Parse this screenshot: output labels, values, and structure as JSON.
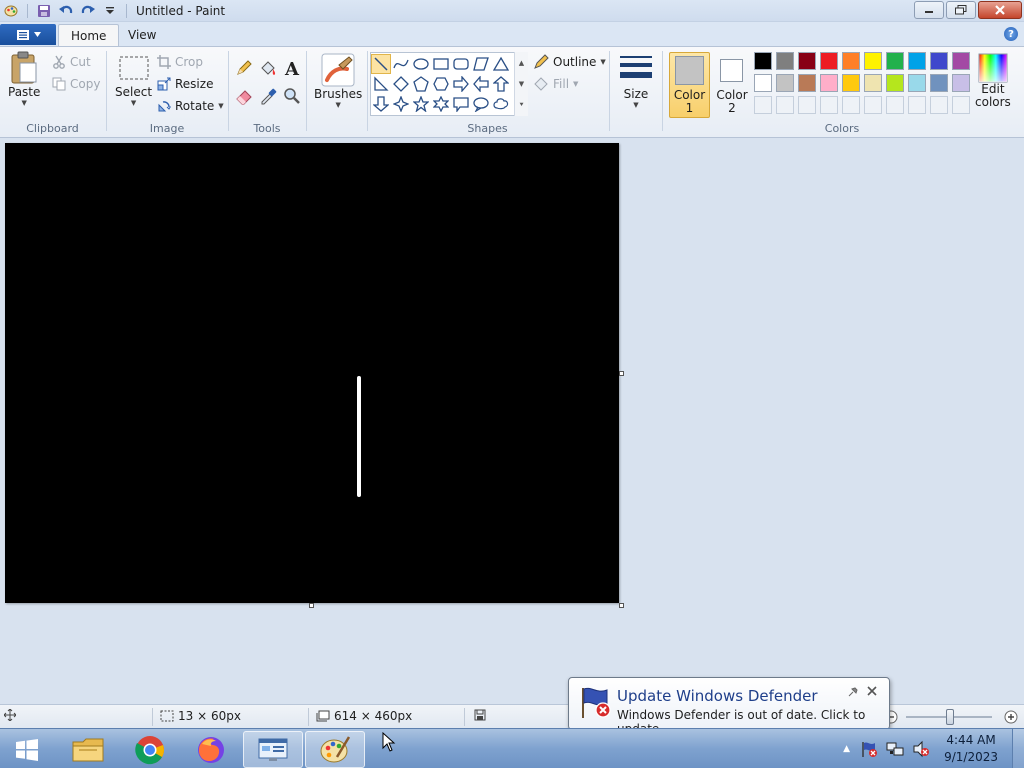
{
  "window": {
    "title": "Untitled - Paint"
  },
  "tabs": [
    {
      "label": "Home"
    },
    {
      "label": "View"
    }
  ],
  "ribbon": {
    "clipboard": {
      "label": "Clipboard",
      "paste": "Paste",
      "cut": "Cut",
      "copy": "Copy"
    },
    "image": {
      "label": "Image",
      "select": "Select",
      "crop": "Crop",
      "resize": "Resize",
      "rotate": "Rotate"
    },
    "tools": {
      "label": "Tools"
    },
    "brushes": {
      "label": "Brushes"
    },
    "shapes": {
      "label": "Shapes",
      "outline": "Outline",
      "fill": "Fill"
    },
    "size": {
      "label": "Size"
    },
    "colors": {
      "label": "Colors",
      "color1_line1": "Color",
      "color1_line2": "1",
      "color2_line1": "Color",
      "color2_line2": "2",
      "edit_line1": "Edit",
      "edit_line2": "colors",
      "color1": "#c3c3c3",
      "color2": "#ffffff",
      "palette_row1": [
        "#000000",
        "#7f7f7f",
        "#880015",
        "#ed1c24",
        "#ff7f27",
        "#fff200",
        "#22b14c",
        "#00a2e8",
        "#3f48cc",
        "#a349a4"
      ],
      "palette_row2": [
        "#ffffff",
        "#c3c3c3",
        "#b97a57",
        "#ffaec9",
        "#ffc90e",
        "#efe4b0",
        "#b5e61d",
        "#99d9ea",
        "#7092be",
        "#c8bfe7"
      ]
    }
  },
  "canvas": {
    "background": "#000000",
    "stroke_color": "#ffffff"
  },
  "status": {
    "selection_size": "13 × 60px",
    "canvas_size": "614 × 460px"
  },
  "notification": {
    "title": "Update Windows Defender",
    "message": "Windows Defender is out of date. Click to update."
  },
  "taskbar": {
    "time": "4:44 AM",
    "date": "9/1/2023"
  }
}
